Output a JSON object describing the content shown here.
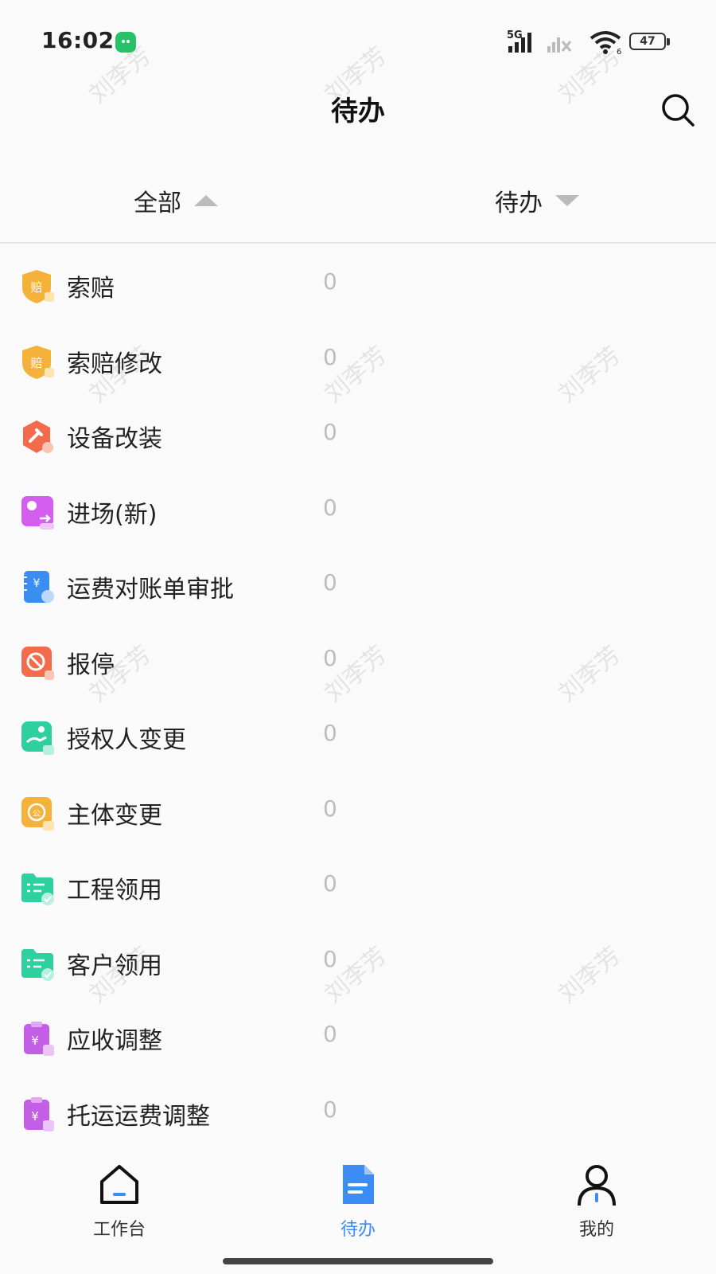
{
  "status_bar": {
    "time": "16:02",
    "signal_label": "5G",
    "wifi_badge": "6",
    "battery": "47"
  },
  "header": {
    "title": "待办"
  },
  "filters": {
    "all_label": "全部",
    "status_label": "待办"
  },
  "items": [
    {
      "label": "索赔",
      "count": "0",
      "icon": "claim-shield-icon",
      "color": "#f5b23b"
    },
    {
      "label": "索赔修改",
      "count": "0",
      "icon": "claim-edit-shield-icon",
      "color": "#f5b23b"
    },
    {
      "label": "设备改装",
      "count": "0",
      "icon": "wrench-hexagon-icon",
      "color": "#f26b4a"
    },
    {
      "label": "进场(新)",
      "count": "0",
      "icon": "location-entry-icon",
      "color": "#d45ef0"
    },
    {
      "label": "运费对账单审批",
      "count": "0",
      "icon": "freight-statement-icon",
      "color": "#3a8ef0"
    },
    {
      "label": "报停",
      "count": "0",
      "icon": "stop-sign-icon",
      "color": "#f26b4a"
    },
    {
      "label": "授权人变更",
      "count": "0",
      "icon": "authorized-person-icon",
      "color": "#2fd0a0"
    },
    {
      "label": "主体变更",
      "count": "0",
      "icon": "entity-change-icon",
      "color": "#f5b23b"
    },
    {
      "label": "工程领用",
      "count": "0",
      "icon": "folder-check-icon",
      "color": "#2fd0a0"
    },
    {
      "label": "客户领用",
      "count": "0",
      "icon": "folder-check-icon",
      "color": "#2fd0a0"
    },
    {
      "label": "应收调整",
      "count": "0",
      "icon": "receivable-clipboard-icon",
      "color": "#c35ee6"
    },
    {
      "label": "托运运费调整",
      "count": "0",
      "icon": "shipping-clipboard-icon",
      "color": "#c35ee6"
    }
  ],
  "watermark": "刘李芳",
  "tabbar": {
    "work": "工作台",
    "todo": "待办",
    "mine": "我的",
    "active_color": "#3b8cf5"
  }
}
